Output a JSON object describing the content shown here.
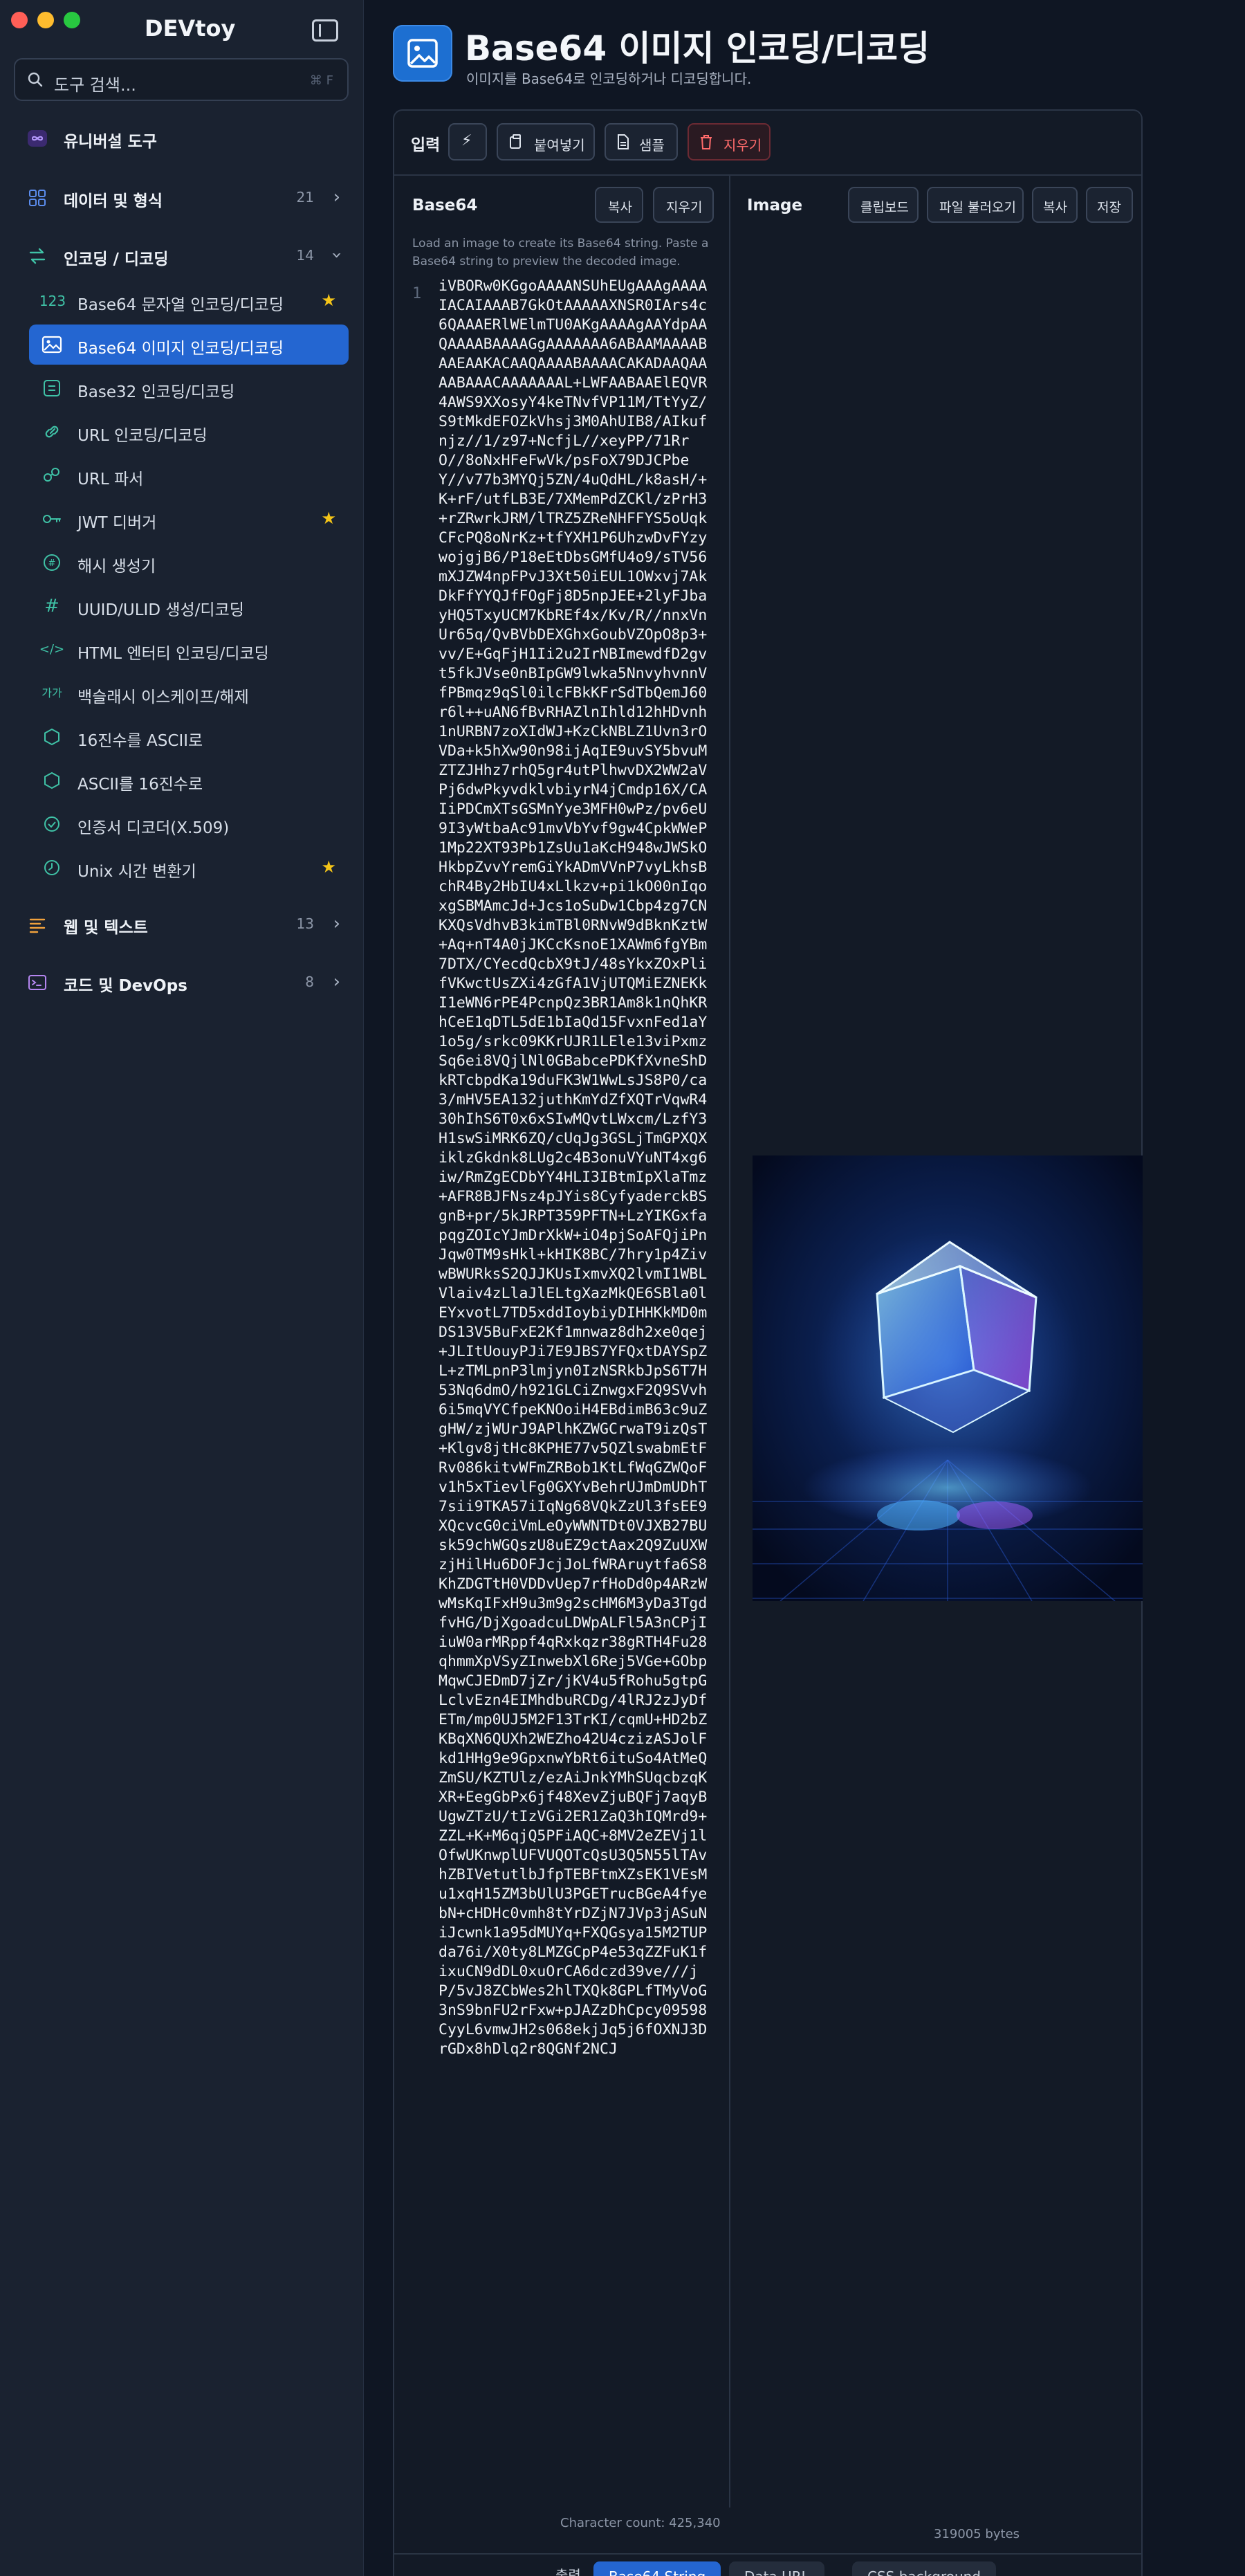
{
  "app": {
    "title": "DEVtoy"
  },
  "search": {
    "placeholder": "도구 검색...",
    "shortcut": "⌘ F"
  },
  "sidebar": {
    "universal": {
      "label": "유니버설 도구"
    },
    "data_format": {
      "label": "데이터 및 형식",
      "count": "21"
    },
    "encode_decode": {
      "label": "인코딩 / 디코딩",
      "count": "14"
    },
    "items": [
      {
        "label": "Base64 문자열 인코딩/디코딩",
        "icon": "123",
        "starred": "★"
      },
      {
        "label": "Base64 이미지 인코딩/디코딩",
        "icon": "image-icon"
      },
      {
        "label": "Base32 인코딩/디코딩",
        "icon": "base32-icon"
      },
      {
        "label": "URL 인코딩/디코딩",
        "icon": "link-icon"
      },
      {
        "label": "URL 파서",
        "icon": "url-parser-icon"
      },
      {
        "label": "JWT 디버거",
        "icon": "key-icon",
        "starred": "★"
      },
      {
        "label": "해시 생성기",
        "icon": "hash-icon"
      },
      {
        "label": "UUID/ULID 생성/디코딩",
        "icon": "hashtag-icon"
      },
      {
        "label": "HTML 엔터티 인코딩/디코딩",
        "icon": "code-icon"
      },
      {
        "label": "백슬래시 이스케이프/해제",
        "icon": "가가"
      },
      {
        "label": "16진수를 ASCII로",
        "icon": "hexagon-icon"
      },
      {
        "label": "ASCII를 16진수로",
        "icon": "hexagon-icon"
      },
      {
        "label": "인증서 디코더(X.509)",
        "icon": "certificate-icon"
      },
      {
        "label": "Unix 시간 변환기",
        "icon": "clock-icon",
        "starred": "★"
      }
    ],
    "web_text": {
      "label": "웹 및 텍스트",
      "count": "13"
    },
    "code_devops": {
      "label": "코드 및 DevOps",
      "count": "8"
    }
  },
  "header": {
    "title": "Base64 이미지 인코딩/디코딩",
    "subtitle": "이미지를 Base64로 인코딩하거나 디코딩합니다."
  },
  "toolbar": {
    "label": "입력",
    "paste": "붙여넣기",
    "sample": "샘플",
    "clear": "지우기"
  },
  "left_pane": {
    "title": "Base64",
    "copy": "복사",
    "clear": "지우기",
    "hint": "Load an image to create its Base64 string. Paste a Base64 string to preview the decoded image.",
    "line_number": "1",
    "code": "iVBORw0KGgoAAAANSUhEUgAAAgAAAAIACAIAAAB7GkOtAAAAAXNSR0IArs4c6QAAAERlWElmTU0AKgAAAAgAAYdpAAQAAAABAAAAGgAAAAAAA6ABAAMAAAABAAEAAKACAAQAAAABAAAACAKADAAQAAAABAAACAAAAAAAL+LWFAABAAElEQVR4AWS9XXosyY4keTNvfVP11M/TtYyZ/S9tMkdEFOZkVhsj3M0AhUIB8/AIkufnjz//1/z97+NcfjL//xeyPP/71RrO//8oNxHFeFwVk/psFoX79DJCPbeY//v77b3MYQj5ZN/4uQdHL/k8asH/+K+rF/utfLB3E/7XMemPdZCKl/zPrH3+rZRwrkJRM/lTRZ5ZReNHFFYS5oUqkCFcPQ8oNrKz+tfYXH1P6UhzwDvFYzywojgjB6/P18eEtDbsGMfU4o9/sTV56mXJZW4npFPvJ3Xt50iEUL1OWxvj7AkDkFfYYQJfFOgFj8D5npJEE+2lyFJbayHQ5TxyUCM7KbREf4x/Kv/R//nnxVnUr65q/QvBVbDEXGhxGoubVZOpO8p3+vv/E+GqFjH1Ii2u2IrNBImewdfD2gvt5fkJVse0nBIpGW9lwka5NnvyhvnnVfPBmqz9qSl0ilcFBkKFrSdTbQemJ60r6l++uAN6fBvRHAZlnIhld12hHDvnh1nURBN7zoXIdWJ+KzCkNBLZ1Uvn3rOVDa+k5hXw90n98ijAqIE9uvSY5bvuMZTZJHhz7rhQ5gr4utPlhwvDX2WW2aVPj6dwPkyvdklvbiyrN4jCmdp16X/CAIiPDCmXTsGSMnYye3MFH0wPz/pv6eU9I3yWtbaAc91mvVbYvf9gw4CpkWWeP1Mp22XT93Pb1ZsUu1aKcH948wJWSkOHkbpZvvYremGiYkADmVVnP7vyLkhsBchR4By2HbIU4xLlkzv+pi1kO00nIqoxgSBMAmcJd+Jcs1oSuDw1Cbp4zg7CNKXQsVdhvB3kimTBl0RNvW9dBknKztW+Aq+nT4A0jJKCcKsnoE1XAWm6fgYBm7DTX/CYecdQcbX9tJ/48sYkxZOxPlifVKwctUsZXi4zGfA1VjUTQMiEZNEKkI1eWN6rPE4PcnpQz3BR1Am8k1nQhKRhCeE1qDTL5dE1bIaQd15FvxnFed1aY1o5g/srkc09KKrUJR1LEle13viPxmzSq6ei8VQjlNl0GBabcePDKfXvneShDkRTcbpdKa19duFK3W1WwLsJS8P0/ca3/mHV5EA132juthKmYdZfXQTrVqwR430hIhS6T0x6xSIwMQvtLWxcm/LzfY3H1swSiMRK6ZQ/cUqJg3GSLjTmGPXQXiklzGkdnk8LUg2c4B3onuVYuNT4xg6iw/RmZgECDbYY4HLI3IBtmIpXlaTmz+AFR8BJFNsz4pJYis8CyfyaderckBSgnB+pr/5kJRPT359PFTN+LzYIKGxfapqgZOIcYJmDrXkW+iO4pjSoAFQjiPnJqw0TM9sHkl+kHIK8BC/7hry1p4ZivwBWURksS2QJJKUsIxmvXQ2lvmI1WBLVlaiv4zLlaJlELtgXazMkQE6SBla0lEYxvotL7TD5xddIoybiyDIHHKkMD0mDS13V5BuFxE2Kf1mnwaz8dh2xe0qej+JLItUouyPJi7E9JBS7YFQxtDAYSpZL+zTMLpnP3lmjyn0IzNSRkbJpS6T7H53Nq6dmO/h921GLCiZnwgxF2Q9SVvh6i5mqVYCfpeKNOoiH4EBdimB63c9uZgHW/zjWUrJ9APlhKZWGCrwaT9izQsT+Klgv8jtHc8KPHE77v5QZlswabmEtFRv086kitvWFmZRBob1KtLfWqGZWQoFv1h5xTievlFg0GXYvBehrUJmDmUDhT7sii9TKA57iIqNg68VQkZzUl3fsEE9XQcvcG0ciVmLeOyWWNTDt0VJXB27BUsk59chWGQszU8uEZ9ctAax2Q9ZuUXWzjHilHu6DOFJcjJoLfWRAruytfa6S8KhZDGTtH0VDDvUep7rfHoDd0p4ARzWwMsKqIFxH9u3m9g2scHM6M3yDa3TgdfvHG/DjXgoadcuLDWpALFl5A3nCPjIiuW0arMRppf4qRxkqzr38gRTH4Fu28qhmmXpVSyZInwebXl6Rej5VGe+GObpMqwCJEDmD7jZr/jKV4u5fRohu5gtpGLclvEzn4EIMhdbuRCDg/4lRJ2zJyDfETm/mp0UJ5M2F13TrKI/cqmU+HD2bZKBqXN6QUXh2WEZho42U4czizASJolFkd1HHg9e9GpxnwYbRt6ituSo4AtMeQZmSU/KZTUlz/ezAiJnkYMhSUqcbzqKXR+EegGbPx6jf48XevZjuBQFj7aqyBUgwZTzU/tIzVGi2ER1ZaQ3hIQMrd9+ZZL+K+M6qjQ5PFiAQC+8MV2eZEVj1lOfwUKnwplUFVUQOTcQsU3Q5N55lTAvhZBIVetutlbJfpTEBFtmXZsEK1VEsMu1xqH15ZM3bUlU3PGETrucBGeA4fyebN+cHDHc0vmh8tYrDZjN7JVp3jASuNiJcwnk1a95dMUYq+FXQGsya15M2TUPda76i/X0ty8LMZGCpP4e53qZZFuK1fixuCN9dDL0xuOrCA6dczd39ve///jP/5vJ8ZCbWes2hlTXQk8GPLfTMyVoG3nS9bnFU2rFxw+pJAZzDhCpcy09598CyyL6vmwJH2s068ekjJq5j6fOXNJ3DrGDx8hDlq2r8QGNf2NCJ"
  },
  "right_pane": {
    "title": "Image",
    "clipboard": "클립보드",
    "load_file": "파일 불러오기",
    "copy": "복사",
    "save": "저장"
  },
  "status": {
    "char_count": "Character count: 425,340",
    "bytes": "319005 bytes"
  },
  "bottom_tabs": {
    "label": "출력",
    "items": [
      "Base64 String",
      "Data URL",
      "CSS background"
    ]
  }
}
